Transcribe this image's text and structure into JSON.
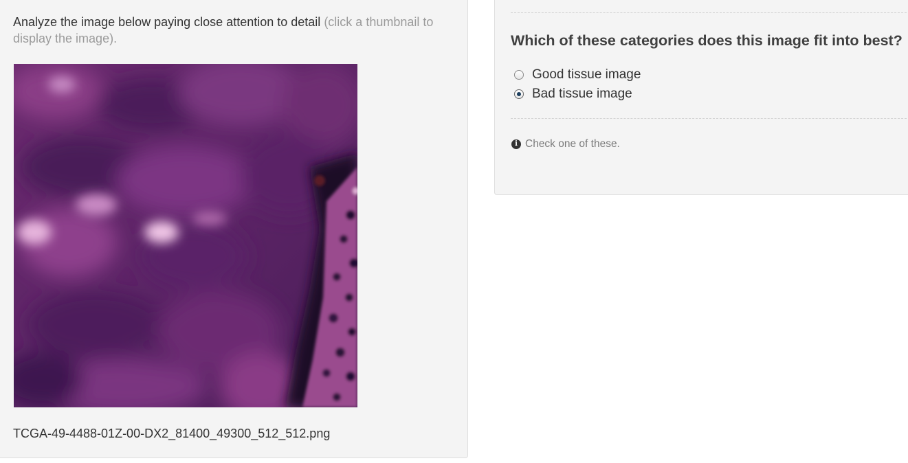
{
  "instructions": {
    "main_text": "Analyze the image below paying close attention to detail",
    "hint_text": "(click a thumbnail to display the image)."
  },
  "image": {
    "filename": "TCGA-49-4488-01Z-00-DX2_81400_49300_512_512.png"
  },
  "question": {
    "title": "Which of these categories does this image fit into best?",
    "options": [
      {
        "label": "Good tissue image",
        "selected": false
      },
      {
        "label": "Bad tissue image",
        "selected": true
      }
    ],
    "help_text": "Check one of these."
  },
  "colors": {
    "panel_background": "#f4f4f4",
    "hint_text": "#9a9a9a",
    "radio_dot": "#1d3f5e"
  }
}
